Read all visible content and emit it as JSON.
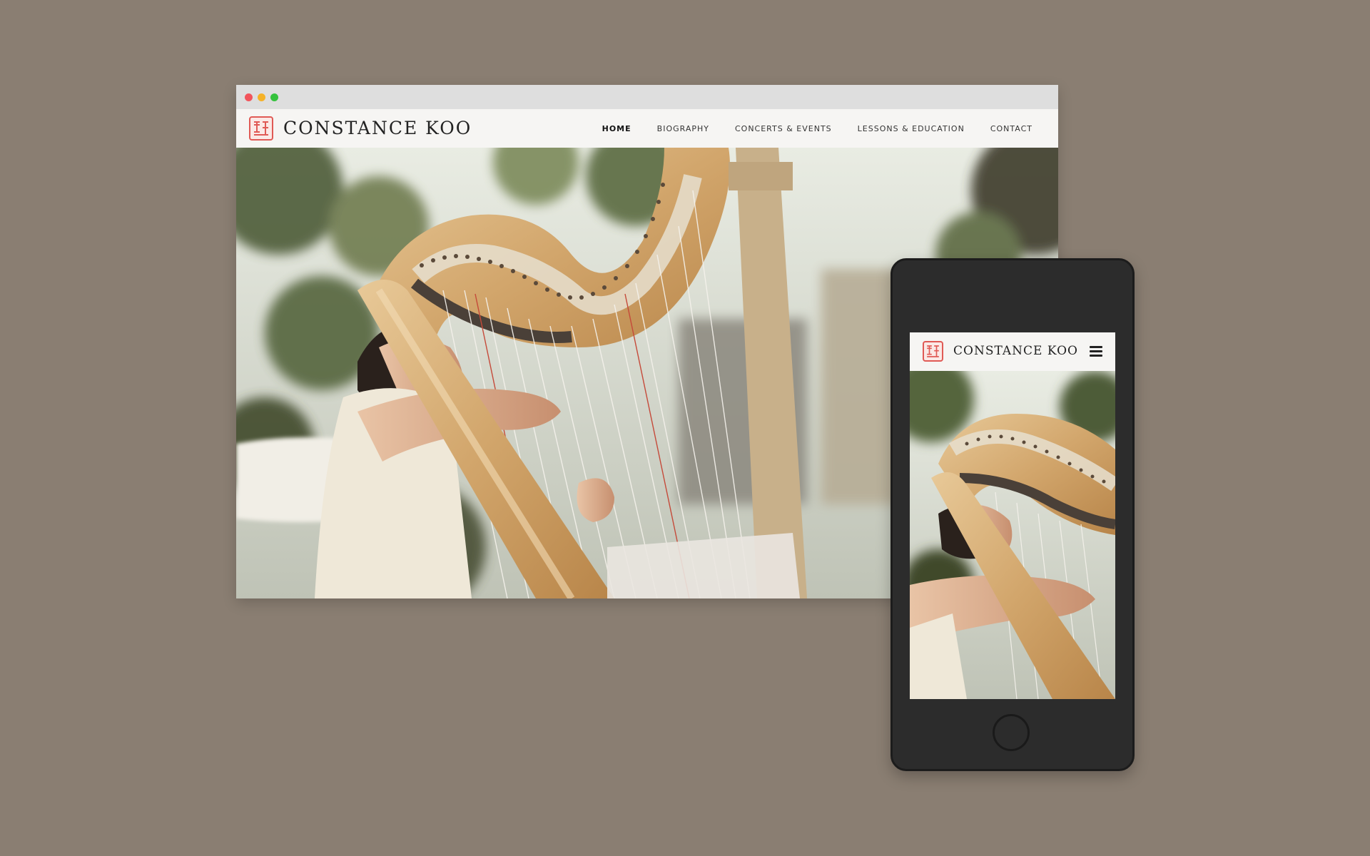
{
  "site": {
    "title": "CONSTANCE KOO",
    "logo": "red-seal-stamp",
    "nav": [
      {
        "label": "HOME",
        "active": true
      },
      {
        "label": "BIOGRAPHY",
        "active": false
      },
      {
        "label": "CONCERTS & EVENTS",
        "active": false
      },
      {
        "label": "LESSONS & EDUCATION",
        "active": false
      },
      {
        "label": "CONTACT",
        "active": false
      }
    ]
  },
  "mobile": {
    "title": "CONSTANCE KOO",
    "menu_icon": "hamburger-icon"
  },
  "hero": {
    "image": "harpist playing a golden harp outdoors under trees"
  },
  "colors": {
    "background": "#8a7e72",
    "seal": "#e05a55",
    "header": "#f6f5f3",
    "phone_body": "#2c2c2c"
  }
}
